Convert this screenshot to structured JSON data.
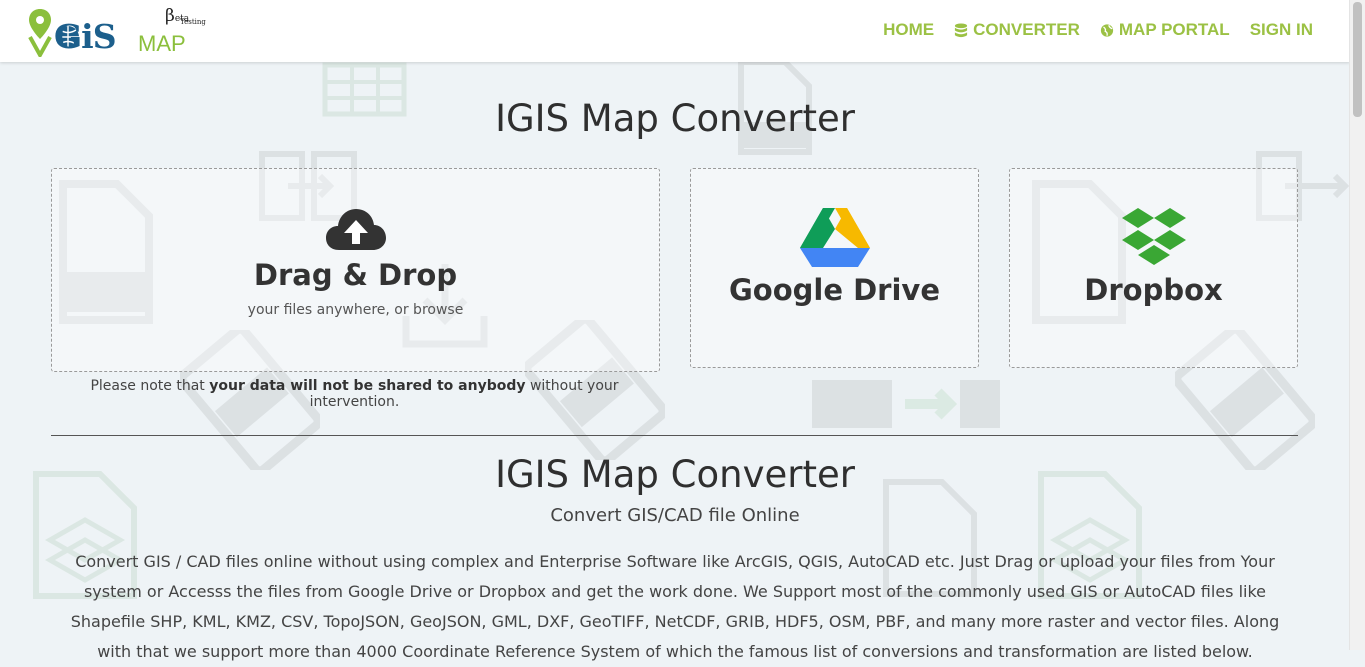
{
  "brand": {
    "logo_main": "GiS",
    "logo_map": "MAP",
    "beta_symbol": "β",
    "beta_suffix": "eta",
    "beta_note": "Testing"
  },
  "nav": {
    "items": [
      {
        "label": "HOME",
        "icon": "none"
      },
      {
        "label": "CONVERTER",
        "icon": "database-icon"
      },
      {
        "label": "MAP PORTAL",
        "icon": "globe-icon"
      },
      {
        "label": "SIGN IN",
        "icon": "none"
      }
    ],
    "color": "#9bc144"
  },
  "main": {
    "title": "IGIS Map Converter",
    "upload": {
      "title": "Drag & Drop",
      "subtitle": "your files anywhere, or browse",
      "icon": "cloud-upload-icon"
    },
    "google_drive": {
      "title": "Google Drive",
      "icon": "google-drive-icon"
    },
    "dropbox": {
      "title": "Dropbox",
      "icon": "dropbox-icon",
      "color": "#3aa734"
    },
    "privacy": {
      "prefix": "Please note that ",
      "bold": "your data will not be shared to anybody",
      "suffix": " without your intervention."
    }
  },
  "section": {
    "title": "IGIS Map Converter",
    "subtitle": "Convert GIS/CAD file Online",
    "body": "Convert GIS / CAD files online without using complex and Enterprise Software like ArcGIS, QGIS, AutoCAD etc. Just Drag or upload your files from Your system or Accesss the files from Google Drive or Dropbox and get the work done. We Support most of the commonly used GIS or AutoCAD files like Shapefile SHP, KML, KMZ, CSV, TopoJSON, GeoJSON, GML, DXF, GeoTIFF, NetCDF, GRIB, HDF5, OSM, PBF, and many more raster and vector files. Along with that we support more than 4000 Coordinate Reference System of which the famous list of conversions and transformation are listed below."
  }
}
